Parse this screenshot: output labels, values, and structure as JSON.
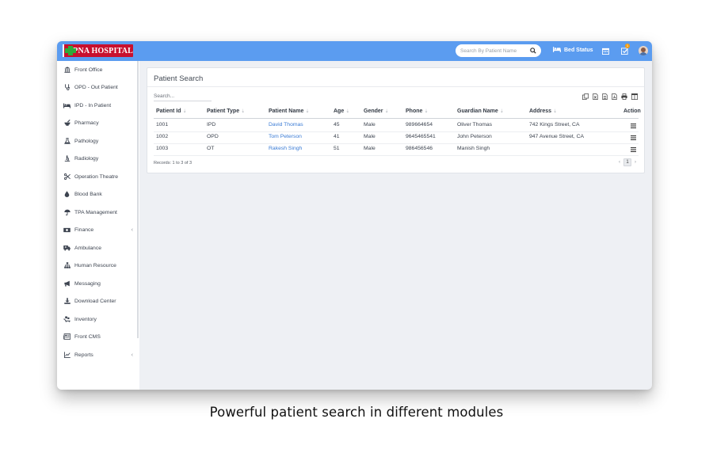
{
  "app": {
    "logo_text": "APNA HOSPITAL"
  },
  "topbar": {
    "search_placeholder": "Search By Patient Name",
    "bed_status_label": "Bed Status",
    "notification_count": "1",
    "accent_color": "#5b9cf0"
  },
  "sidebar": {
    "items": [
      {
        "label": "Front Office",
        "icon": "building-icon",
        "has_submenu": false
      },
      {
        "label": "OPD - Out Patient",
        "icon": "stethoscope-icon",
        "has_submenu": false
      },
      {
        "label": "IPD - In Patient",
        "icon": "bed-icon",
        "has_submenu": false
      },
      {
        "label": "Pharmacy",
        "icon": "mortar-pestle-icon",
        "has_submenu": false
      },
      {
        "label": "Pathology",
        "icon": "flask-icon",
        "has_submenu": false
      },
      {
        "label": "Radiology",
        "icon": "microscope-icon",
        "has_submenu": false
      },
      {
        "label": "Operation Theatre",
        "icon": "scissors-icon",
        "has_submenu": false
      },
      {
        "label": "Blood Bank",
        "icon": "blood-drop-icon",
        "has_submenu": false
      },
      {
        "label": "TPA Management",
        "icon": "umbrella-icon",
        "has_submenu": false
      },
      {
        "label": "Finance",
        "icon": "money-icon",
        "has_submenu": true
      },
      {
        "label": "Ambulance",
        "icon": "ambulance-icon",
        "has_submenu": false
      },
      {
        "label": "Human Resource",
        "icon": "sitemap-icon",
        "has_submenu": false
      },
      {
        "label": "Messaging",
        "icon": "megaphone-icon",
        "has_submenu": false
      },
      {
        "label": "Download Center",
        "icon": "download-icon",
        "has_submenu": false
      },
      {
        "label": "Inventory",
        "icon": "inventory-icon",
        "has_submenu": false
      },
      {
        "label": "Front CMS",
        "icon": "newspaper-icon",
        "has_submenu": false
      },
      {
        "label": "Reports",
        "icon": "line-chart-icon",
        "has_submenu": true
      }
    ]
  },
  "main": {
    "title": "Patient Search",
    "table_search_placeholder": "Search...",
    "export_icons": [
      "copy-icon",
      "excel-icon",
      "csv-icon",
      "pdf-icon",
      "print-icon",
      "columns-icon"
    ],
    "columns": [
      "Patient Id",
      "Patient Type",
      "Patient Name",
      "Age",
      "Gender",
      "Phone",
      "Guardian Name",
      "Address",
      "Action"
    ],
    "rows": [
      {
        "patient_id": "1001",
        "patient_type": "IPD",
        "patient_name": "David Thomas",
        "age": "45",
        "gender": "Male",
        "phone": "989664654",
        "guardian_name": "Oliver Thomas",
        "address": "742 Kings Street, CA"
      },
      {
        "patient_id": "1002",
        "patient_type": "OPD",
        "patient_name": "Tom Peterson",
        "age": "41",
        "gender": "Male",
        "phone": "9645465541",
        "guardian_name": "John Peterson",
        "address": "947 Avenue Street, CA"
      },
      {
        "patient_id": "1003",
        "patient_type": "OT",
        "patient_name": "Rakesh Singh",
        "age": "51",
        "gender": "Male",
        "phone": "986456546",
        "guardian_name": "Manish Singh",
        "address": ""
      }
    ],
    "records_text": "Records: 1 to 3 of 3",
    "pagination": {
      "prev": "‹",
      "current": "1",
      "next": "›"
    }
  },
  "caption": "Powerful patient search in different modules"
}
